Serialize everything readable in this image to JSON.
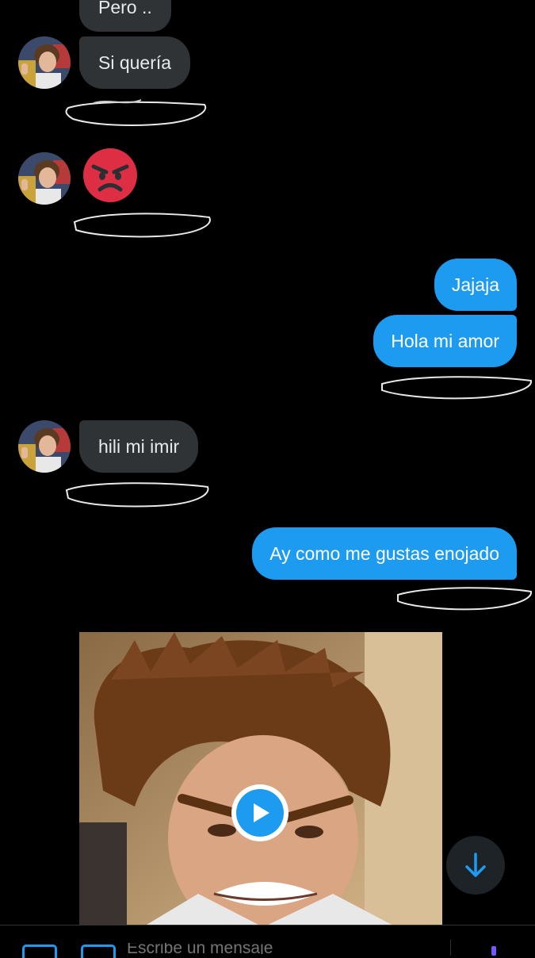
{
  "messages": [
    {
      "side": "in",
      "text": "Pero .."
    },
    {
      "side": "in",
      "text": "Si quería"
    },
    {
      "side": "in",
      "emoji": "angry-face"
    },
    {
      "side": "out",
      "text": "Jajaja"
    },
    {
      "side": "out",
      "text": "Hola mi amor"
    },
    {
      "side": "in",
      "text": "hili mi imir"
    },
    {
      "side": "out",
      "text": "Ay como me gustas enojado"
    },
    {
      "side": "in",
      "media": "video"
    }
  ],
  "composer": {
    "placeholder": "Escribe un mensaje"
  },
  "colors": {
    "incoming_bubble": "#2f3336",
    "outgoing_bubble": "#1d9bf0",
    "background": "#000000",
    "accent": "#1d9bf0"
  },
  "icons": [
    "angry-face-emoji",
    "play-icon",
    "arrow-down-icon",
    "image-icon",
    "gif-icon",
    "send-icon"
  ]
}
